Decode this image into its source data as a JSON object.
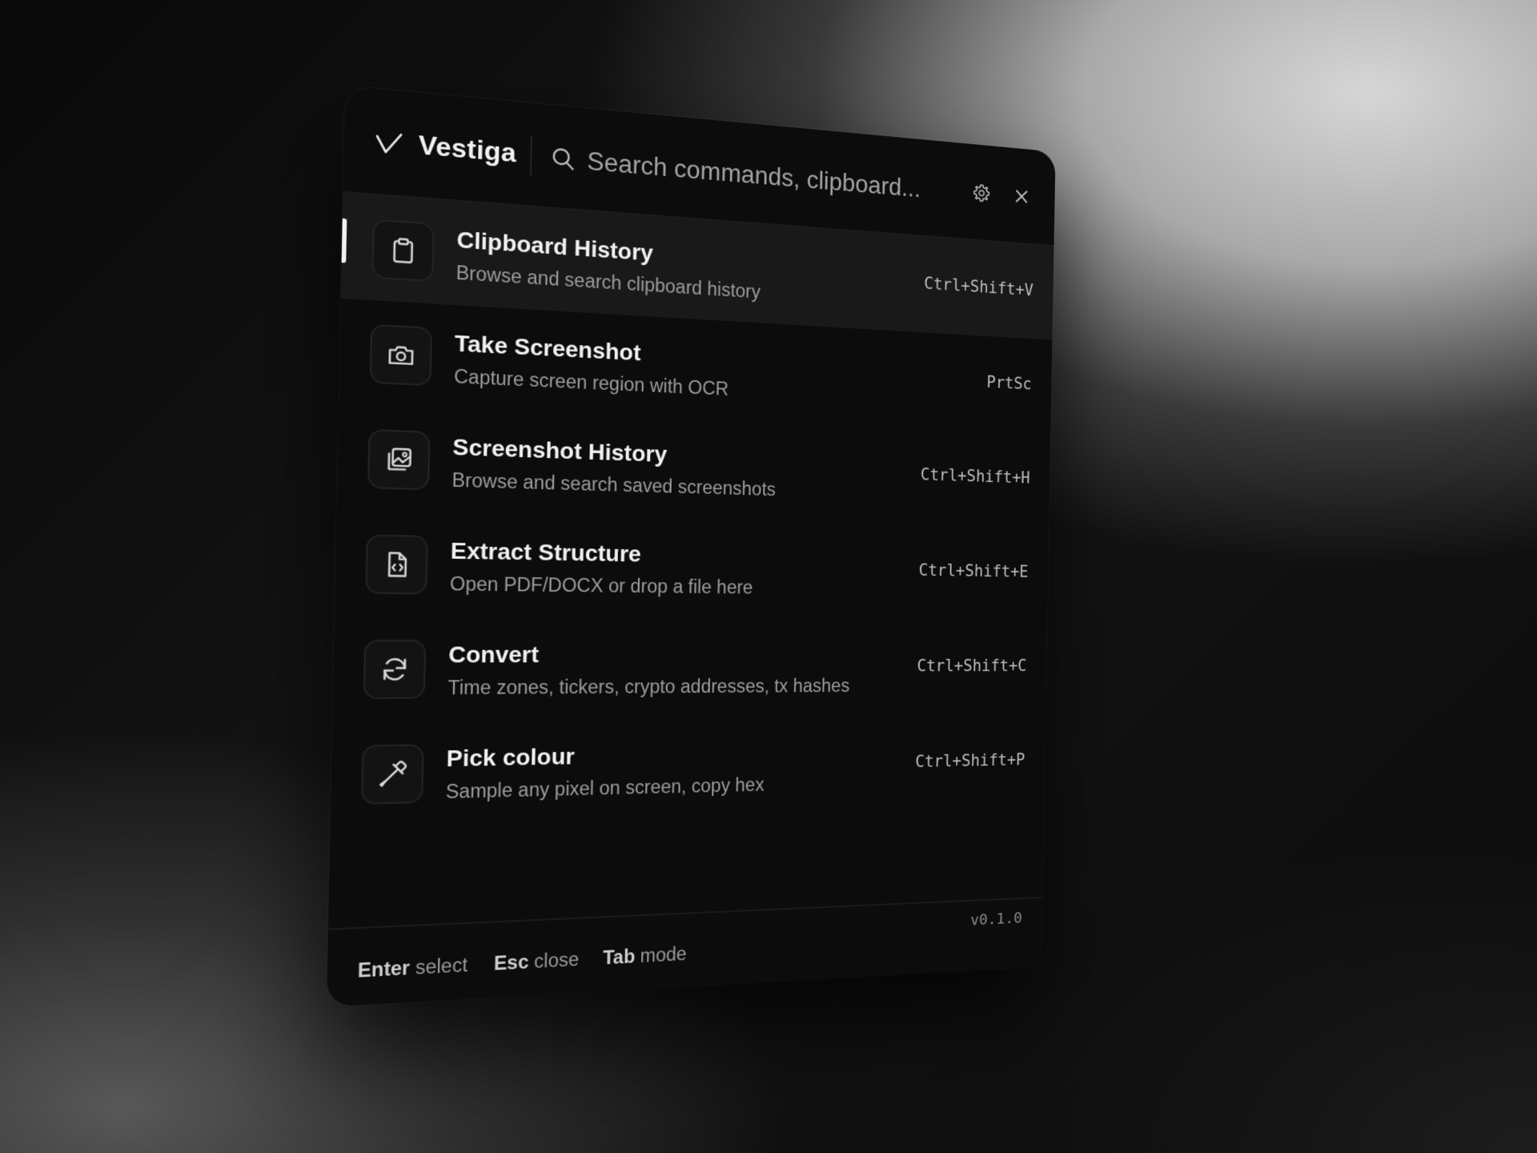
{
  "app": {
    "name": "Vestiga",
    "logo_icon": "vestiga-v-logo",
    "version": "v0.1.0"
  },
  "search": {
    "placeholder": "Search commands, clipboard...",
    "value": ""
  },
  "header_actions": {
    "settings_icon": "gear-icon",
    "close_icon": "close-icon"
  },
  "commands": [
    {
      "title": "Clipboard History",
      "description": "Browse and search clipboard history",
      "shortcut": "Ctrl+Shift+V",
      "icon": "clipboard-icon",
      "selected": true
    },
    {
      "title": "Take Screenshot",
      "description": "Capture screen region with OCR",
      "shortcut": "PrtSc",
      "icon": "camera-icon",
      "selected": false
    },
    {
      "title": "Screenshot History",
      "description": "Browse and search saved screenshots",
      "shortcut": "Ctrl+Shift+H",
      "icon": "image-stack-icon",
      "selected": false
    },
    {
      "title": "Extract Structure",
      "description": "Open PDF/DOCX or drop a file here",
      "shortcut": "Ctrl+Shift+E",
      "icon": "file-code-icon",
      "selected": false
    },
    {
      "title": "Convert",
      "description": "Time zones, tickers, crypto addresses, tx hashes",
      "shortcut": "Ctrl+Shift+C",
      "icon": "refresh-icon",
      "selected": false
    },
    {
      "title": "Pick colour",
      "description": "Sample any pixel on screen, copy hex",
      "shortcut": "Ctrl+Shift+P",
      "icon": "eyedropper-icon",
      "selected": false
    }
  ],
  "footer": {
    "hints": [
      {
        "key": "Enter",
        "action": "select"
      },
      {
        "key": "Esc",
        "action": "close"
      },
      {
        "key": "Tab",
        "action": "mode"
      }
    ]
  },
  "colors": {
    "panel_bg": "#0c0c0c",
    "selected_row_bg": "#191919",
    "accent": "#f2f2f2"
  }
}
